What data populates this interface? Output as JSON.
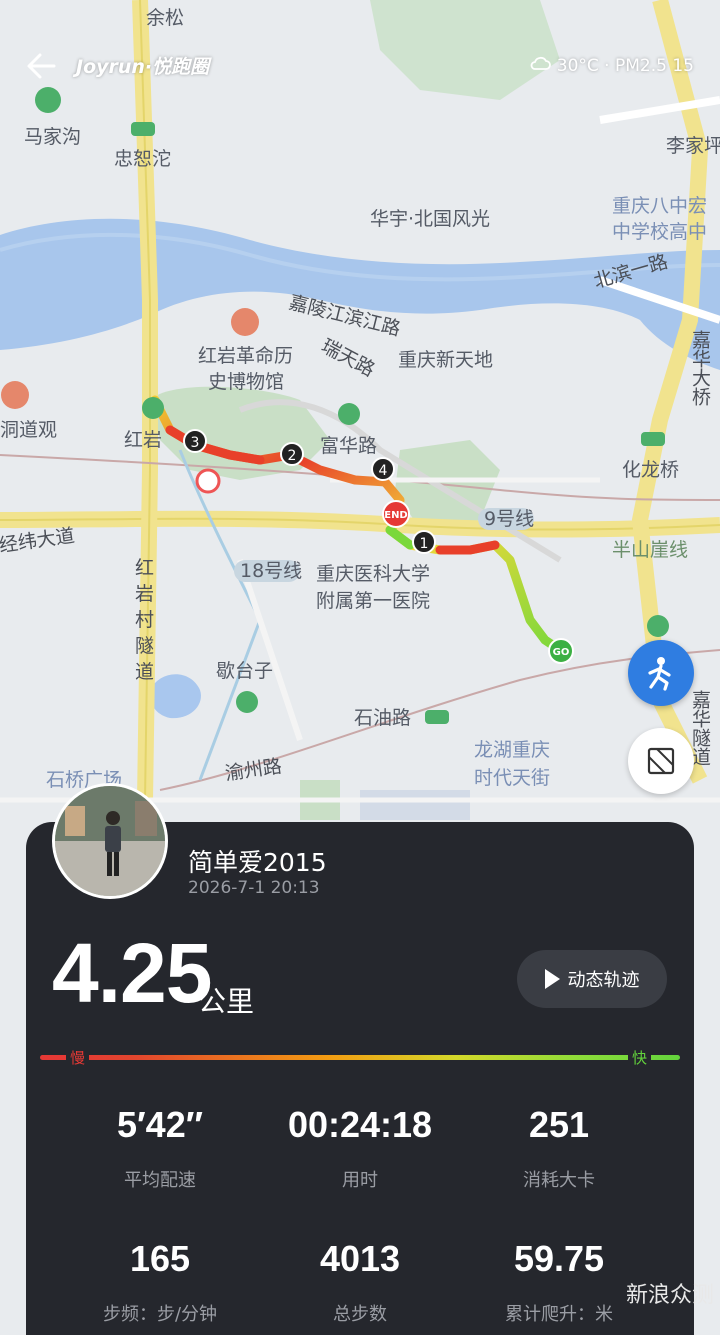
{
  "header": {
    "back_icon": "arrow-left-icon",
    "brand": "Joyrun·悦跑圈",
    "weather_icon": "cloud-icon",
    "weather": "30°C · PM2.5 15"
  },
  "map": {
    "labels": {
      "yusong": "余松",
      "majiagou": "马家沟",
      "zhongshuoduo": "忠恕沱",
      "lijiaping": "李家坪",
      "chongqing8_1": "重庆八中宏",
      "chongqing8_2": "中学校高中",
      "huayu": "华宇·北国风光",
      "beibin": "北滨一路",
      "jialingjiang": "嘉陵江滨江路",
      "ruitianlu": "瑞天路",
      "xintiandi": "重庆新天地",
      "hongyan_museum_1": "红岩革命历",
      "hongyan_museum_2": "史博物馆",
      "dongdaoguan": "洞道观",
      "hongyan": "红岩",
      "fuhualu": "富华路",
      "jiahuadaqiao": "嘉华大桥",
      "hualongqiao": "化龙桥",
      "jingwei": "经纬大道",
      "line9": "9号线",
      "banshanyaxian": "半山崖线",
      "line18": "18号线",
      "hospital_1": "重庆医科大学",
      "hospital_2": "附属第一医院",
      "hongyancun_1": "红",
      "hongyancun_2": "岩",
      "hongyancun_3": "村",
      "hongyancun_4": "隧",
      "hongyancun_5": "道",
      "getaizi": "歇台子",
      "shiyoulu": "石油路",
      "longhu_1": "龙湖重庆",
      "longhu_2": "时代天街",
      "shiqiaopu": "石桥广场",
      "yuzhoulu": "渝州路",
      "jiahuatunnel": "嘉华隧道",
      "end": "END",
      "go": "GO",
      "km1": "1",
      "km2": "2",
      "km3": "3",
      "km4": "4"
    }
  },
  "buttons": {
    "run_mode_icon": "runner-icon",
    "fit_icon": "fit-route-icon"
  },
  "card": {
    "username": "简单爱2015",
    "datetime": "2026-7-1 20:13",
    "distance": "4.25",
    "distance_unit": "公里",
    "replay_label": "动态轨迹",
    "slow_label": "慢",
    "fast_label": "快",
    "stats": [
      {
        "value": "5′42″",
        "label": "平均配速"
      },
      {
        "value": "00:24:18",
        "label": "用时"
      },
      {
        "value": "251",
        "label": "消耗大卡"
      },
      {
        "value": "165",
        "label": "步频：步/分钟"
      },
      {
        "value": "4013",
        "label": "总步数"
      },
      {
        "value": "59.75",
        "label": "累计爬升：米"
      }
    ]
  },
  "watermark": "新浪众测",
  "colors": {
    "card_bg": "#25272d",
    "accent_blue": "#2f7de1",
    "slow": "#e53935",
    "fast": "#63d33c"
  }
}
